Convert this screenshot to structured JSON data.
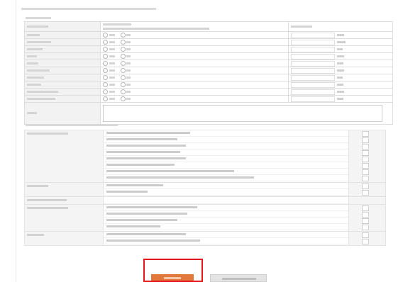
{
  "page": {
    "heading": "",
    "section1_label": "",
    "section2_label": ""
  },
  "form_table": {
    "header": {
      "col1": "",
      "col2": "",
      "col3": ""
    },
    "sub_header": {
      "col2": ""
    },
    "rows": [
      {
        "label": "",
        "option1": "",
        "option2": "",
        "value": ""
      },
      {
        "label": "",
        "option1": "",
        "option2": "",
        "value": ""
      },
      {
        "label": "",
        "option1": "",
        "option2": "",
        "value": ""
      },
      {
        "label": "",
        "option1": "",
        "option2": "",
        "value": ""
      },
      {
        "label": "",
        "option1": "",
        "option2": "",
        "value": ""
      },
      {
        "label": "",
        "option1": "",
        "option2": "",
        "value": ""
      },
      {
        "label": "",
        "option1": "",
        "option2": "",
        "value": ""
      },
      {
        "label": "",
        "option1": "",
        "option2": "",
        "value": ""
      },
      {
        "label": "",
        "option1": "",
        "option2": "",
        "value": ""
      },
      {
        "label": "",
        "option1": "",
        "option2": "",
        "value": ""
      }
    ],
    "note": {
      "label": "",
      "value": ""
    }
  },
  "checklist": {
    "groups": [
      {
        "label": "",
        "items": [
          "",
          "",
          "",
          "",
          "",
          "",
          "",
          ""
        ]
      },
      {
        "label": "",
        "items": [
          "",
          ""
        ]
      },
      {
        "label": "",
        "items": []
      },
      {
        "label": "",
        "items": [
          "",
          "",
          "",
          ""
        ]
      },
      {
        "label": "",
        "items": [
          "",
          ""
        ]
      }
    ]
  },
  "buttons": {
    "primary_label": "",
    "secondary_label": ""
  },
  "colors": {
    "primary_button": "#e0793b",
    "highlight_border": "#e8141c",
    "table_header": "#f2f2f2",
    "table_border": "#dddddd"
  }
}
